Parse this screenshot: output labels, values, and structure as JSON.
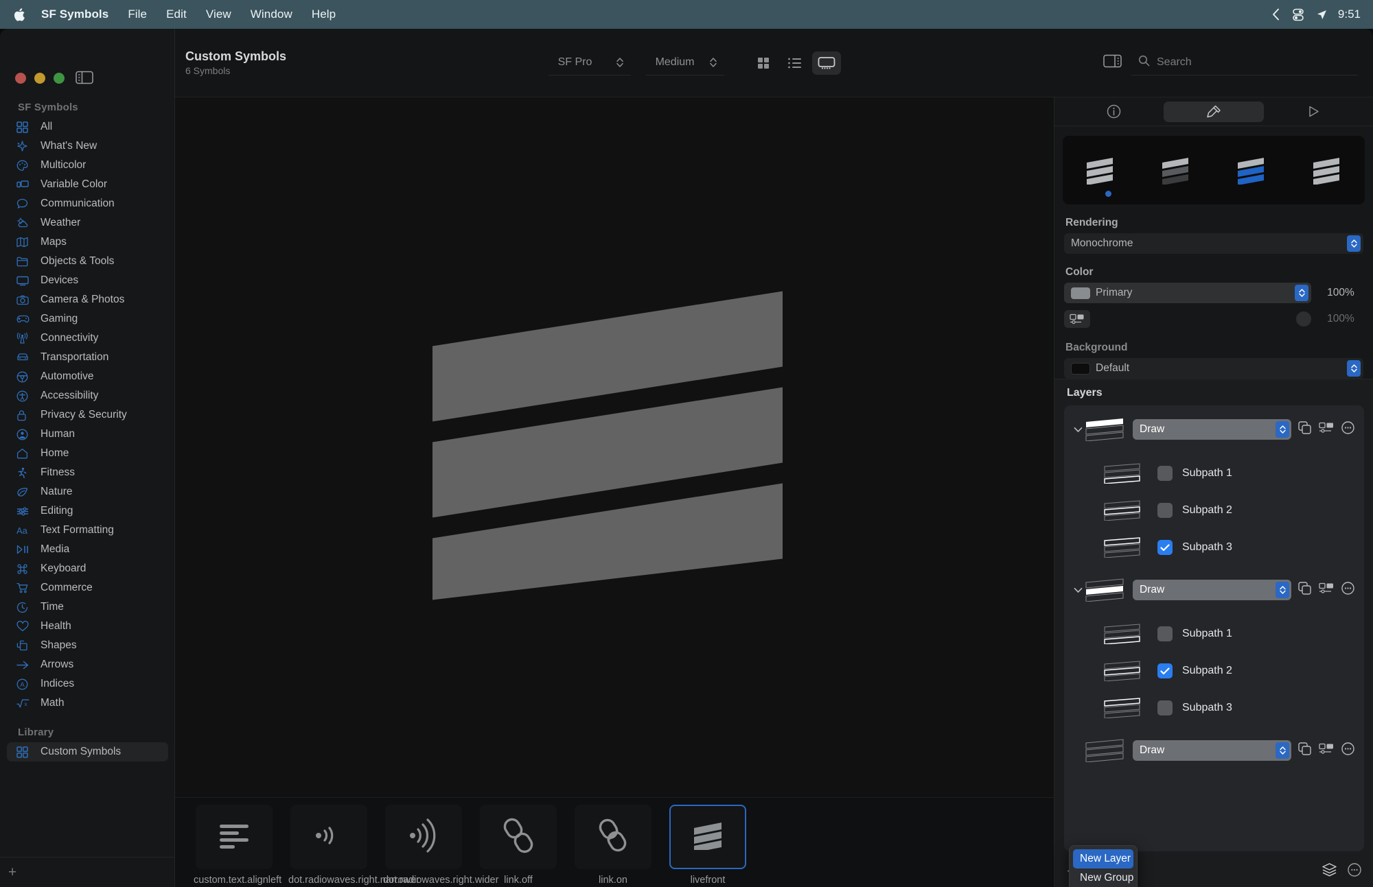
{
  "menubar": {
    "apple_icon": "apple-logo-icon",
    "items": [
      "SF Symbols",
      "File",
      "Edit",
      "View",
      "Window",
      "Help"
    ],
    "status_icons": [
      "chevron-left-icon",
      "control-center-icon",
      "location-arrow-icon"
    ],
    "clock": "9:51"
  },
  "window": {
    "traffic_lights": [
      "close-button",
      "minimize-button",
      "zoom-button"
    ],
    "sidebar_toggle_icon": "sidebar-toggle-icon"
  },
  "sidebar": {
    "sections": [
      {
        "header": "SF Symbols",
        "items": [
          {
            "label": "All",
            "icon": "grid-icon"
          },
          {
            "label": "What's New",
            "icon": "sparkle-icon"
          },
          {
            "label": "Multicolor",
            "icon": "palette-icon"
          },
          {
            "label": "Variable Color",
            "icon": "variable-color-icon"
          },
          {
            "label": "Communication",
            "icon": "bubble-icon"
          },
          {
            "label": "Weather",
            "icon": "cloud-sun-icon"
          },
          {
            "label": "Maps",
            "icon": "map-icon"
          },
          {
            "label": "Objects & Tools",
            "icon": "folder-icon"
          },
          {
            "label": "Devices",
            "icon": "display-icon"
          },
          {
            "label": "Camera & Photos",
            "icon": "camera-icon"
          },
          {
            "label": "Gaming",
            "icon": "gamecontroller-icon"
          },
          {
            "label": "Connectivity",
            "icon": "antenna-icon"
          },
          {
            "label": "Transportation",
            "icon": "car-icon"
          },
          {
            "label": "Automotive",
            "icon": "steeringwheel-icon"
          },
          {
            "label": "Accessibility",
            "icon": "accessibility-icon"
          },
          {
            "label": "Privacy & Security",
            "icon": "lock-icon"
          },
          {
            "label": "Human",
            "icon": "person-icon"
          },
          {
            "label": "Home",
            "icon": "house-icon"
          },
          {
            "label": "Fitness",
            "icon": "figure-run-icon"
          },
          {
            "label": "Nature",
            "icon": "leaf-icon"
          },
          {
            "label": "Editing",
            "icon": "sliders-icon"
          },
          {
            "label": "Text Formatting",
            "icon": "textformat-icon"
          },
          {
            "label": "Media",
            "icon": "playpause-icon"
          },
          {
            "label": "Keyboard",
            "icon": "command-icon"
          },
          {
            "label": "Commerce",
            "icon": "cart-icon"
          },
          {
            "label": "Time",
            "icon": "clock-icon"
          },
          {
            "label": "Health",
            "icon": "heart-icon"
          },
          {
            "label": "Shapes",
            "icon": "shapes-icon"
          },
          {
            "label": "Arrows",
            "icon": "arrow-right-icon"
          },
          {
            "label": "Indices",
            "icon": "circle-a-icon"
          },
          {
            "label": "Math",
            "icon": "sqrt-icon"
          }
        ]
      },
      {
        "header": "Library",
        "items": [
          {
            "label": "Custom Symbols",
            "icon": "grid-icon",
            "selected": true
          }
        ]
      }
    ],
    "add_button": "+"
  },
  "toolbar": {
    "title": "Custom Symbols",
    "subtitle": "6 Symbols",
    "font_popup": "SF Pro",
    "weight_popup": "Medium",
    "view_modes": [
      {
        "name": "grid-view-icon",
        "active": false
      },
      {
        "name": "list-view-icon",
        "active": false
      },
      {
        "name": "gallery-view-icon",
        "active": true
      }
    ],
    "inspector_toggle_icon": "inspector-toggle-icon",
    "search": {
      "placeholder": "Search",
      "value": "",
      "icon": "search-icon"
    }
  },
  "canvas": {
    "symbol_name": "livefront",
    "stripe_color": "#636363",
    "background": "#111112"
  },
  "gallery": {
    "symbols": [
      {
        "name": "custom.text.alignleft",
        "icon": "text-alignleft-icon",
        "selected": false
      },
      {
        "name": "dot.radiowaves.right.narrower",
        "icon": "radiowaves-narrow-icon",
        "selected": false
      },
      {
        "name": "dot.radiowaves.right.wider",
        "icon": "radiowaves-wide-icon",
        "selected": false
      },
      {
        "name": "link.off",
        "icon": "link-off-icon",
        "selected": false
      },
      {
        "name": "link.on",
        "icon": "link-on-icon",
        "selected": false
      },
      {
        "name": "livefront",
        "icon": "livefront-icon",
        "selected": true
      }
    ]
  },
  "inspector": {
    "tabs": [
      {
        "name": "info-tab",
        "icon": "info-circle-icon",
        "active": false
      },
      {
        "name": "style-tab",
        "icon": "paintbrush-icon",
        "active": true
      },
      {
        "name": "animation-tab",
        "icon": "play-triangle-icon",
        "active": false
      }
    ],
    "preview_variants": [
      "monochrome-preview",
      "hierarchical-preview",
      "palette-preview",
      "multicolor-preview"
    ],
    "selected_variant_index": 0,
    "rendering": {
      "label": "Rendering",
      "value": "Monochrome"
    },
    "color": {
      "label": "Color",
      "primary": {
        "value": "Primary",
        "swatch": "#8a8d8f",
        "opacity": "100%"
      },
      "secondary": {
        "opacity": "100%"
      }
    },
    "background": {
      "label": "Background",
      "value": "Default",
      "swatch": "#0d0d0e"
    }
  },
  "layers": {
    "title": "Layers",
    "groups": [
      {
        "draw_label": "Draw",
        "expanded": true,
        "highlight_index": 0,
        "subpaths": [
          {
            "label": "Subpath 1",
            "checked": false,
            "highlight": 2
          },
          {
            "label": "Subpath 2",
            "checked": false,
            "highlight": 1
          },
          {
            "label": "Subpath 3",
            "checked": true,
            "highlight": 0
          }
        ],
        "actions": [
          "duplicate-layer-icon",
          "layer-options-icon",
          "more-options-icon"
        ]
      },
      {
        "draw_label": "Draw",
        "expanded": true,
        "highlight_index": 1,
        "subpaths": [
          {
            "label": "Subpath 1",
            "checked": false,
            "highlight": 2
          },
          {
            "label": "Subpath 2",
            "checked": true,
            "highlight": 1
          },
          {
            "label": "Subpath 3",
            "checked": false,
            "highlight": 0
          }
        ],
        "actions": [
          "duplicate-layer-icon",
          "layer-options-icon",
          "more-options-icon"
        ]
      },
      {
        "draw_label": "Draw",
        "expanded": false,
        "highlight_index": 0,
        "subpaths": [],
        "actions": [
          "duplicate-layer-icon",
          "layer-options-icon",
          "more-options-icon"
        ]
      }
    ],
    "footer": {
      "add_icon": "+",
      "stack_icon": "layers-stack-icon",
      "more_icon": "more-options-icon"
    }
  },
  "context_menu": {
    "items": [
      {
        "label": "New Layer",
        "highlighted": true
      },
      {
        "label": "New Group",
        "highlighted": false
      }
    ]
  },
  "colors": {
    "accent": "#2a68c4",
    "checkbox_on": "#2a7ef0",
    "menubar_bg": "#3b545d",
    "sidebar_bg": "#161718",
    "inspector_bg": "#161718",
    "layers_bg": "#24262a"
  }
}
